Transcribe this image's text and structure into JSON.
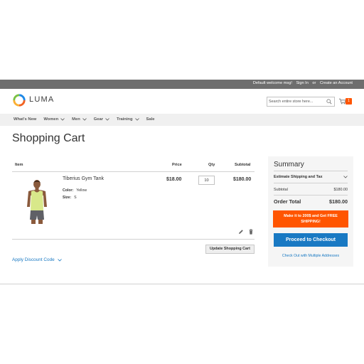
{
  "topbar": {
    "welcome": "Default welcome msg!",
    "sign_in": "Sign In",
    "or": "or",
    "create_account": "Create an Account"
  },
  "header": {
    "logo_text": "LUMA",
    "search_placeholder": "Search entire store here...",
    "cart_count": "1"
  },
  "nav": {
    "items": [
      {
        "label": "What's New",
        "has_dropdown": false
      },
      {
        "label": "Women",
        "has_dropdown": true
      },
      {
        "label": "Men",
        "has_dropdown": true
      },
      {
        "label": "Gear",
        "has_dropdown": true
      },
      {
        "label": "Training",
        "has_dropdown": true
      },
      {
        "label": "Sale",
        "has_dropdown": false
      }
    ]
  },
  "page": {
    "title": "Shopping Cart"
  },
  "cart": {
    "headers": {
      "item": "Item",
      "price": "Price",
      "qty": "Qty",
      "subtotal": "Subtotal"
    },
    "items": [
      {
        "name": "Tiberius Gym Tank",
        "options": [
          {
            "label": "Color:",
            "value": "Yellow"
          },
          {
            "label": "Size:",
            "value": "S"
          }
        ],
        "price": "$18.00",
        "qty": "10",
        "subtotal": "$180.00"
      }
    ],
    "update_button": "Update Shopping Cart",
    "apply_discount": "Apply Discount Code"
  },
  "summary": {
    "title": "Summary",
    "estimate": "Estimate Shipping and Tax",
    "subtotal_label": "Subtotal",
    "subtotal_value": "$180.00",
    "order_total_label": "Order Total",
    "order_total_value": "$180.00",
    "promo": "Make it to 200$ and Get FREE SHIPPING!",
    "checkout_button": "Proceed to Checkout",
    "multi_address": "Check Out with Multiple Addresses"
  },
  "colors": {
    "accent_orange": "#ff5501",
    "link_blue": "#1979c3",
    "topbar_gray": "#6e6e6e",
    "nav_bg": "#f0f0f0"
  }
}
